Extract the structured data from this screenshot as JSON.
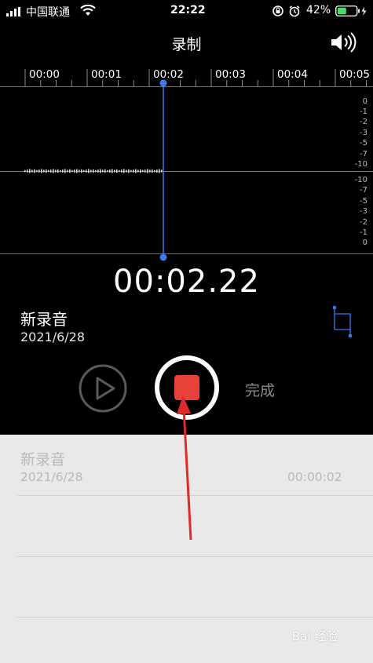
{
  "status_bar": {
    "carrier": "中国联通",
    "time": "22:22",
    "battery_percent": "42%"
  },
  "nav": {
    "title": "录制",
    "speaker_icon": "speaker-icon"
  },
  "timeline": {
    "ticks": [
      "00:00",
      "00:01",
      "00:02",
      "00:03",
      "00:04",
      "00:05"
    ]
  },
  "db_scale": {
    "upper": [
      "0",
      "-1",
      "-2",
      "-3",
      "-5",
      "-7",
      "-10"
    ],
    "lower": [
      "-10",
      "-7",
      "-5",
      "-3",
      "-2",
      "-1",
      "0"
    ]
  },
  "timer": "00:02.22",
  "recording": {
    "title": "新录音",
    "date": "2021/6/28"
  },
  "controls": {
    "done_label": "完成",
    "play_icon": "play-icon",
    "stop_icon": "stop-icon",
    "trim_icon": "trim-icon"
  },
  "list": {
    "items": [
      {
        "title": "新录音",
        "date": "2021/6/28",
        "duration": "00:00:02"
      }
    ]
  },
  "watermark": "Bai 经验",
  "colors": {
    "accent_blue": "#3b7bef",
    "record_red": "#e8413a",
    "annotation_red": "#e02a2a",
    "list_bg": "#e9e9e9"
  }
}
